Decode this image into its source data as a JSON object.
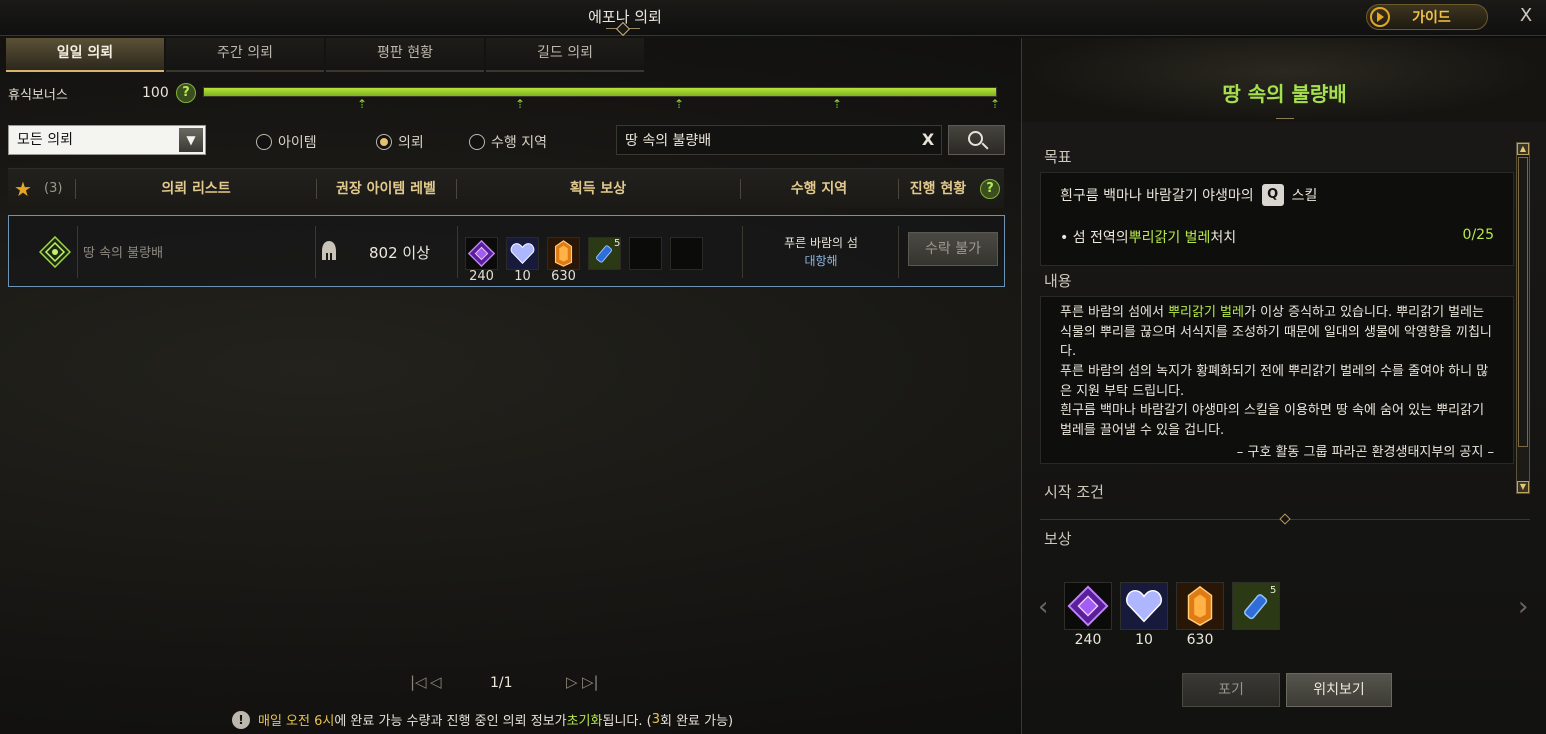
{
  "window": {
    "title": "에포나 의뢰",
    "guide_label": "가이드",
    "close": "X"
  },
  "tabs": [
    {
      "label": "일일 의뢰",
      "active": true
    },
    {
      "label": "주간 의뢰",
      "active": false
    },
    {
      "label": "평판 현황",
      "active": false
    },
    {
      "label": "길드 의뢰",
      "active": false
    }
  ],
  "rest_bonus": {
    "label": "휴식보너스",
    "value": "100",
    "help": "?",
    "fill_percent": 100
  },
  "filter": {
    "select_value": "모든 의뢰",
    "radios": [
      {
        "label": "아이템",
        "checked": false
      },
      {
        "label": "의뢰",
        "checked": true
      },
      {
        "label": "수행 지역",
        "checked": false
      }
    ],
    "search_value": "땅 속의 불량배",
    "clear": "X"
  },
  "table": {
    "favorite_count": "(3)",
    "headers": {
      "list": "의뢰 리스트",
      "level": "권장 아이템 레벨",
      "reward": "획득 보상",
      "region": "수행 지역",
      "progress": "진행 현황"
    },
    "help": "?",
    "row": {
      "name": "땅 속의 불량배",
      "level": "802 이상",
      "rewards": [
        {
          "icon": "purple-gem-icon",
          "count": "240"
        },
        {
          "icon": "crystal-heart-icon",
          "count": "10"
        },
        {
          "icon": "orange-crystal-icon",
          "count": "630"
        },
        {
          "icon": "potion-icon",
          "count": "",
          "stack": "5"
        }
      ],
      "region_name": "푸른 바람의 섬",
      "region_sub": "대항해",
      "action": "수락 불가"
    }
  },
  "pager": {
    "first": "|<<",
    "prev": "<",
    "page": "1/1",
    "next": ">",
    "last": ">>|"
  },
  "notice": {
    "icon": "!",
    "part1": "매일 오전 6시",
    "part2": "에 완료 가능 수량과 진행 중인 의뢰 정보가 ",
    "part3": "초기화",
    "part4": "됩니다. (",
    "part5": "3",
    "part6": "회 완료 가능)"
  },
  "detail": {
    "title": "땅 속의 불량배",
    "objective_title": "목표",
    "objective_line1_a": "흰구름 백마나 바람갈기 야생마의",
    "objective_key": "Q",
    "objective_line1_b": "스킬",
    "objective_line2_a": "• 섬 전역의 ",
    "objective_line2_hl": "뿌리갉기 벌레",
    "objective_line2_b": " 처치",
    "objective_progress": "0/25",
    "content_title": "내용",
    "content_p1_a": "푸른 바람의 섬에서 ",
    "content_p1_hl": "뿌리갉기 벌레",
    "content_p1_b": "가 이상 증식하고 있습니다. 뿌리갉기 벌레는 식물의 뿌리를 끊으며 서식지를 조성하기 때문에 일대의 생물에 악영향을 끼칩니다.",
    "content_p2": "푸른 바람의 섬의 녹지가 황폐화되기 전에 뿌리갉기 벌레의 수를 줄여야 하니 많은 지원 부탁 드립니다.",
    "content_p3": "흰구름 백마나 바람갈기 야생마의 스킬을 이용하면 땅 속에 숨어 있는 뿌리갉기 벌레를 끌어낼 수 있을 겁니다.",
    "content_sign": "– 구호 활동 그룹 파라곤 환경생태지부의 공지 –",
    "start_title": "시작 조건",
    "reward_title": "보상",
    "rewards": [
      {
        "icon": "purple-gem-icon",
        "count": "240"
      },
      {
        "icon": "crystal-heart-icon",
        "count": "10"
      },
      {
        "icon": "orange-crystal-icon",
        "count": "630"
      },
      {
        "icon": "potion-icon",
        "count": "",
        "stack": "5"
      }
    ],
    "giveup_label": "포기",
    "locate_label": "위치보기"
  },
  "colors": {
    "accent_green": "#a5e04e",
    "accent_gold": "#e2c98d",
    "selection_border": "#6f93b5"
  }
}
